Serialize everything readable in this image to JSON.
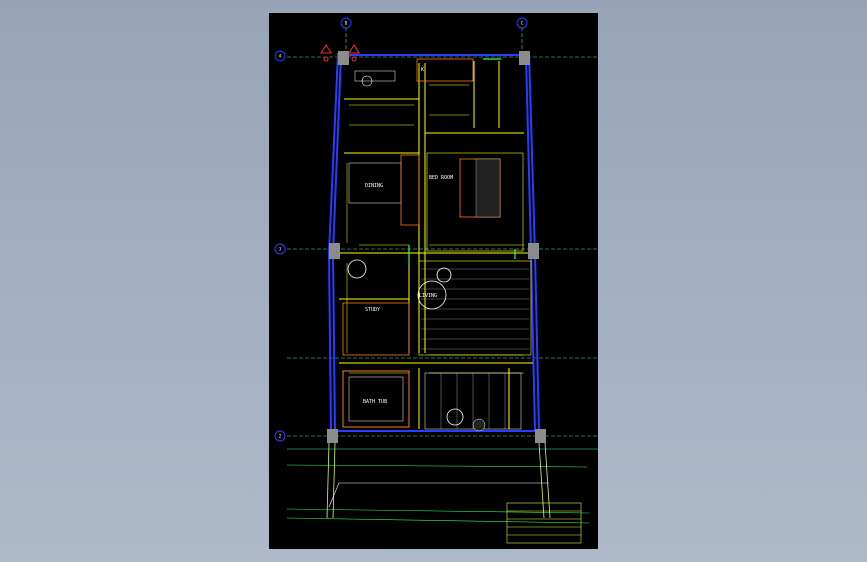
{
  "drawing": {
    "room_labels": {
      "bedroom": "BED ROOM",
      "dining": "DINING",
      "living": "LIVING",
      "study": "STUDY",
      "bath": "BATH TUB",
      "kitchen": "K"
    },
    "grid_axes": {
      "top_left": "B",
      "top_right": "C",
      "left_1": "4",
      "left_2": "3",
      "left_3": "2"
    }
  },
  "colors": {
    "wall_blue": "#2a3cff",
    "furniture_orange": "#ff7a1a",
    "dimension_yellow": "#ffff00",
    "grid_cyan": "#39e6c8",
    "text_white": "#ffffff",
    "column_gray": "#8c8c8c",
    "green": "#2dff4a",
    "red": "#ff2a2a",
    "lime": "#d7ff4a"
  }
}
